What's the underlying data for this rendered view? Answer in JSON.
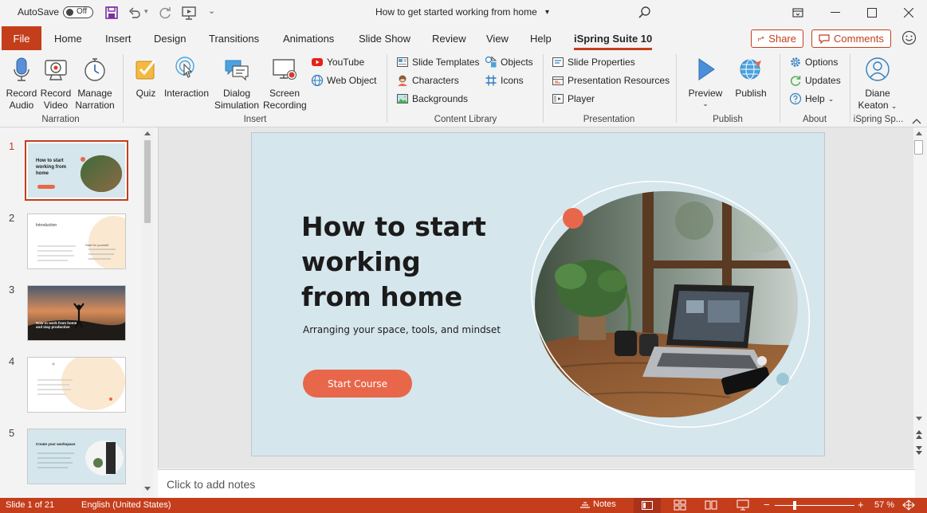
{
  "titlebar": {
    "autosave_label": "AutoSave",
    "autosave_state": "Off",
    "doc_title": "How to get started working from home",
    "title_dropdown": "▾"
  },
  "tabs": {
    "file": "File",
    "items": [
      "Home",
      "Insert",
      "Design",
      "Transitions",
      "Animations",
      "Slide Show",
      "Review",
      "View",
      "Help",
      "iSpring Suite 10"
    ],
    "active": "iSpring Suite 10",
    "share": "Share",
    "comments": "Comments"
  },
  "ribbon": {
    "narration": {
      "record_audio": [
        "Record",
        "Audio"
      ],
      "record_video": [
        "Record",
        "Video"
      ],
      "manage_narration": [
        "Manage",
        "Narration"
      ],
      "group": "Narration"
    },
    "insert": {
      "quiz": "Quiz",
      "interaction": "Interaction",
      "dialog_simulation": [
        "Dialog",
        "Simulation"
      ],
      "screen_recording": [
        "Screen",
        "Recording"
      ],
      "youtube": "YouTube",
      "web_object": "Web Object",
      "group": "Insert"
    },
    "content_library": {
      "slide_templates": "Slide Templates",
      "characters": "Characters",
      "backgrounds": "Backgrounds",
      "objects": "Objects",
      "icons": "Icons",
      "group": "Content Library"
    },
    "presentation": {
      "slide_properties": "Slide Properties",
      "presentation_resources": "Presentation Resources",
      "player": "Player",
      "group": "Presentation"
    },
    "publish": {
      "preview": "Preview",
      "publish": "Publish",
      "group": "Publish"
    },
    "about": {
      "options": "Options",
      "updates": "Updates",
      "help": "Help",
      "group": "About"
    },
    "account": {
      "user": [
        "Diane",
        "Keaton"
      ],
      "group": "iSpring Sp..."
    }
  },
  "slides_panel": {
    "numbers": [
      "1",
      "2",
      "3",
      "4",
      "5"
    ],
    "thumb1": {
      "title": "How to start working from home"
    },
    "thumb2": {
      "title": "Introduction",
      "side": "Start for yourself"
    },
    "thumb3": {
      "title": "How to work from home and stay productive"
    },
    "thumb5": {
      "title": "Create your workspace"
    }
  },
  "slide": {
    "title_lines": [
      "How to start",
      "working",
      "from home"
    ],
    "subtitle": "Arranging your space, tools, and mindset",
    "button": "Start Course",
    "colors": {
      "background": "#d5e6ec",
      "accent": "#e8674a",
      "dot_blue": "#9cc7d6"
    }
  },
  "notes": {
    "placeholder": "Click to add notes"
  },
  "statusbar": {
    "slide_info": "Slide 1 of 21",
    "language": "English (United States)",
    "notes": "Notes",
    "zoom_minus": "−",
    "zoom_plus": "+",
    "zoom_level": "57 %"
  },
  "colors": {
    "brand": "#c43e1c"
  }
}
